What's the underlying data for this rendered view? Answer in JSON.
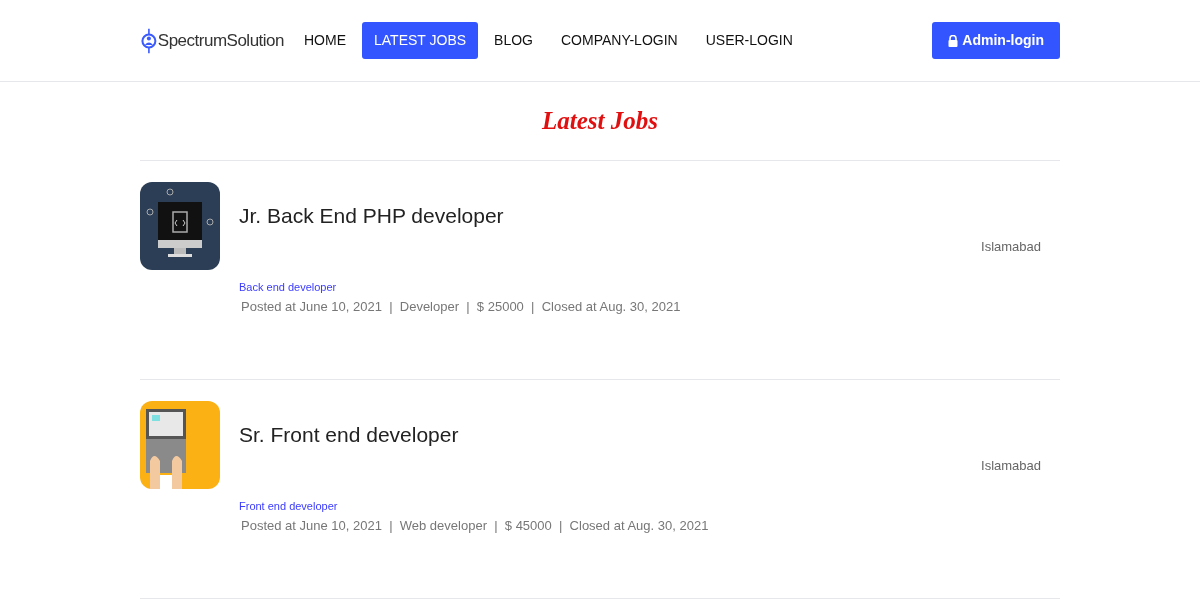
{
  "logo": {
    "text": "SpectrumSolution"
  },
  "nav": [
    {
      "label": "HOME",
      "selected": false
    },
    {
      "label": "LATEST JOBS",
      "selected": true
    },
    {
      "label": "BLOG",
      "selected": false
    },
    {
      "label": "COMPANY-LOGIN",
      "selected": false
    },
    {
      "label": "USER-LOGIN",
      "selected": false
    }
  ],
  "admin_button": {
    "label": "Admin-login"
  },
  "page_title": "Latest Jobs",
  "jobs": [
    {
      "kind": "monitor",
      "title": "Jr. Back End PHP developer",
      "location": "Islamabad",
      "category": "Back end developer",
      "details": "Posted at June 10, 2021  |  Developer  |  $ 25000  |  Closed at Aug. 30, 2021"
    },
    {
      "kind": "laptop",
      "title": "Sr. Front end developer",
      "location": "Islamabad",
      "category": "Front end developer",
      "details": "Posted at June 10, 2021  |  Web developer  |  $ 45000  |  Closed at Aug. 30, 2021"
    }
  ]
}
